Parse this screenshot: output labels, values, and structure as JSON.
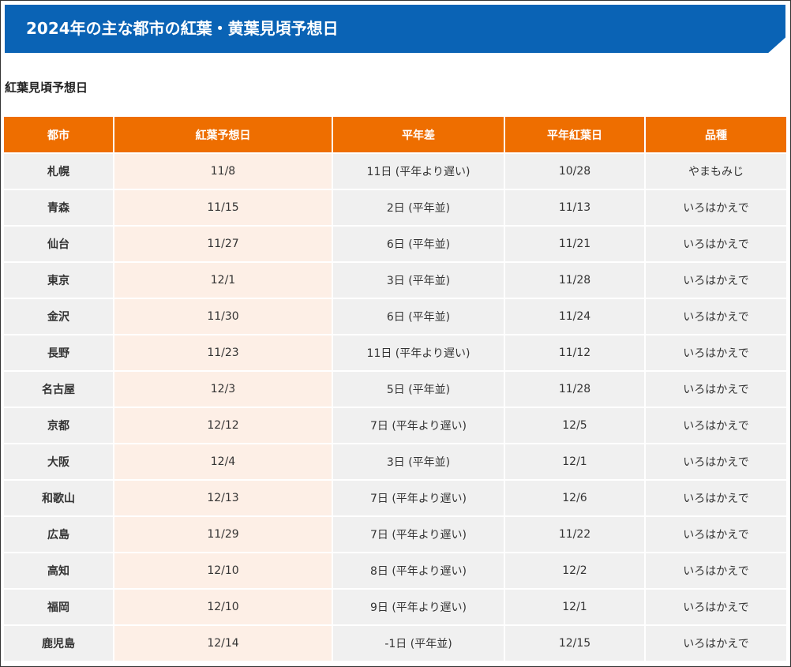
{
  "header": {
    "title": "2024年の主な都市の紅葉・黄葉見頃予想日"
  },
  "section": {
    "subtitle": "紅葉見頃予想日"
  },
  "colors": {
    "title_bar": "#0a63b5",
    "table_header": "#ee6e00",
    "forecast_column": "#fdefe6",
    "row_background": "#f0f0f0"
  },
  "table": {
    "columns": [
      "都市",
      "紅葉予想日",
      "平年差",
      "平年紅葉日",
      "品種"
    ],
    "rows": [
      {
        "city": "札幌",
        "forecast": "11/8",
        "diff": "11日 (平年より遅い)",
        "normal": "10/28",
        "variety": "やまもみじ"
      },
      {
        "city": "青森",
        "forecast": "11/15",
        "diff": "2日 (平年並)",
        "normal": "11/13",
        "variety": "いろはかえで"
      },
      {
        "city": "仙台",
        "forecast": "11/27",
        "diff": "6日 (平年並)",
        "normal": "11/21",
        "variety": "いろはかえで"
      },
      {
        "city": "東京",
        "forecast": "12/1",
        "diff": "3日 (平年並)",
        "normal": "11/28",
        "variety": "いろはかえで"
      },
      {
        "city": "金沢",
        "forecast": "11/30",
        "diff": "6日 (平年並)",
        "normal": "11/24",
        "variety": "いろはかえで"
      },
      {
        "city": "長野",
        "forecast": "11/23",
        "diff": "11日 (平年より遅い)",
        "normal": "11/12",
        "variety": "いろはかえで"
      },
      {
        "city": "名古屋",
        "forecast": "12/3",
        "diff": "5日 (平年並)",
        "normal": "11/28",
        "variety": "いろはかえで"
      },
      {
        "city": "京都",
        "forecast": "12/12",
        "diff": "7日 (平年より遅い)",
        "normal": "12/5",
        "variety": "いろはかえで"
      },
      {
        "city": "大阪",
        "forecast": "12/4",
        "diff": "3日 (平年並)",
        "normal": "12/1",
        "variety": "いろはかえで"
      },
      {
        "city": "和歌山",
        "forecast": "12/13",
        "diff": "7日 (平年より遅い)",
        "normal": "12/6",
        "variety": "いろはかえで"
      },
      {
        "city": "広島",
        "forecast": "11/29",
        "diff": "7日 (平年より遅い)",
        "normal": "11/22",
        "variety": "いろはかえで"
      },
      {
        "city": "高知",
        "forecast": "12/10",
        "diff": "8日 (平年より遅い)",
        "normal": "12/2",
        "variety": "いろはかえで"
      },
      {
        "city": "福岡",
        "forecast": "12/10",
        "diff": "9日 (平年より遅い)",
        "normal": "12/1",
        "variety": "いろはかえで"
      },
      {
        "city": "鹿児島",
        "forecast": "12/14",
        "diff": "-1日 (平年並)",
        "normal": "12/15",
        "variety": "いろはかえで"
      }
    ]
  }
}
